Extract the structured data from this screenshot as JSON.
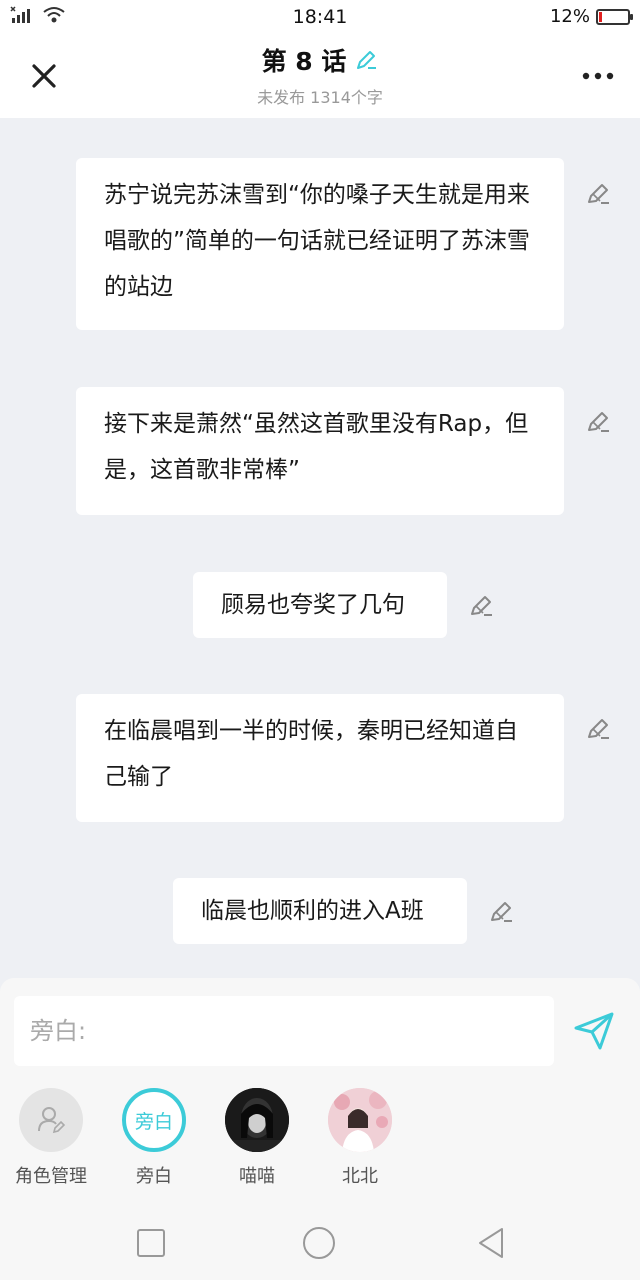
{
  "status_bar": {
    "time": "18:41",
    "battery_percent": "12%",
    "battery_level": 0.12,
    "signal_icon": "signal-icon",
    "wifi_icon": "wifi-icon"
  },
  "header": {
    "title": "第 8 话",
    "subtitle": "未发布 1314个字",
    "close_icon": "close-icon",
    "more_icon": "more-icon",
    "title_edit_icon": "pencil-icon",
    "accent_color": "#3ccbd8"
  },
  "messages": [
    {
      "text": "苏宁说完苏沫雪到“你的嗓子天生就是用来唱歌的”简单的一句话就已经证明了苏沫雪的站边"
    },
    {
      "text": "接下来是萧然“虽然这首歌里没有Rap，但是，这首歌非常棒”"
    },
    {
      "text": "顾易也夸奖了几句"
    },
    {
      "text": "在临晨唱到一半的时候，秦明已经知道自己输了"
    },
    {
      "text": "临晨也顺利的进入A班"
    }
  ],
  "composer": {
    "placeholder": "旁白:",
    "value": "",
    "send_icon": "send-icon"
  },
  "roles": [
    {
      "label": "角色管理",
      "icon": "role-manage-icon"
    },
    {
      "label": "旁白",
      "badge": "旁白",
      "selected": true
    },
    {
      "label": "喵喵",
      "avatar": "avatar-dark"
    },
    {
      "label": "北北",
      "avatar": "avatar-pink"
    }
  ],
  "nav": {
    "recent_icon": "square-icon",
    "home_icon": "circle-icon",
    "back_icon": "triangle-back-icon"
  }
}
